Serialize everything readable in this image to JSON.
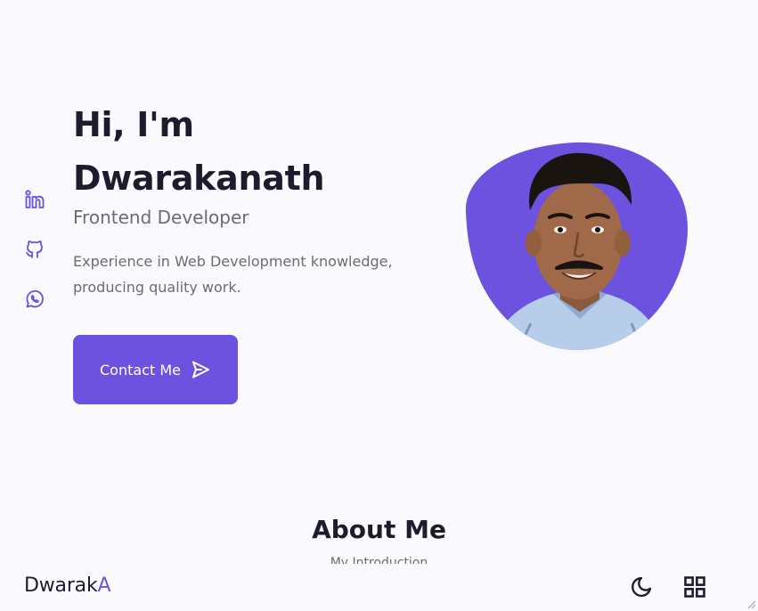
{
  "hero": {
    "greeting": "Hi, I'm",
    "name": "Dwarakanath",
    "subtitle": "Frontend Developer",
    "description": "Experience in Web Development knowledge, producing quality work.",
    "contact_label": "Contact Me"
  },
  "social": {
    "linkedin_icon": "linkedin-icon",
    "github_icon": "github-icon",
    "whatsapp_icon": "whatsapp-icon"
  },
  "about": {
    "title": "About Me",
    "subtitle": "My Introduction"
  },
  "nav": {
    "logo_main": "Dwarak",
    "logo_accent": "A",
    "theme_icon": "moon-icon",
    "menu_icon": "grid-icon"
  },
  "colors": {
    "accent": "#6c52de",
    "background": "#fafafe",
    "title": "#1f1b2d",
    "text": "#6d6a78"
  }
}
